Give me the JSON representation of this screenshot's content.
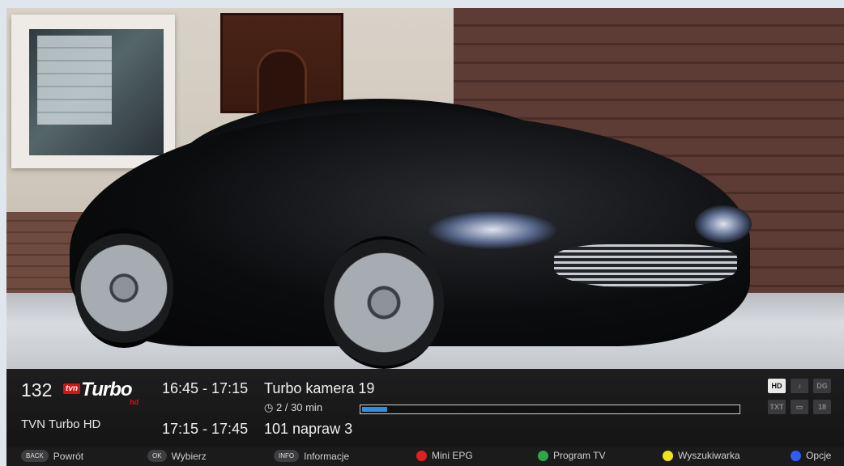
{
  "channel": {
    "number": "132",
    "logo": {
      "tvn": "tvn",
      "turbo": "Turbo",
      "hd": "hd",
      "color": "#d41414"
    },
    "name": "TVN Turbo HD"
  },
  "programs": {
    "current": {
      "time": "16:45 - 17:15",
      "title": "Turbo kamera 19",
      "elapsed": "2 / 30 min",
      "progress_fraction": 0.067
    },
    "next": {
      "time": "17:15 - 17:45",
      "title": "101 napraw 3"
    }
  },
  "badges": [
    {
      "label": "HD",
      "active": true
    },
    {
      "label": "♪",
      "active": false
    },
    {
      "label": "DG",
      "active": false
    },
    {
      "label": "TXT",
      "active": false
    },
    {
      "label": "▭",
      "active": false
    },
    {
      "label": "18",
      "active": false
    }
  ],
  "hints": {
    "back": {
      "key": "BACK",
      "label": "Powrót"
    },
    "ok": {
      "key": "OK",
      "label": "Wybierz"
    },
    "info": {
      "key": "INFO",
      "label": "Informacje"
    },
    "red": {
      "label": "Mini EPG",
      "color": "#e02020"
    },
    "green": {
      "label": "Program TV",
      "color": "#2aa84a"
    },
    "yellow": {
      "label": "Wyszukiwarka",
      "color": "#f2e21a"
    },
    "blue": {
      "label": "Opcje",
      "color": "#2f5ef0"
    }
  },
  "colors": {
    "accent": "#2e8fe0"
  }
}
